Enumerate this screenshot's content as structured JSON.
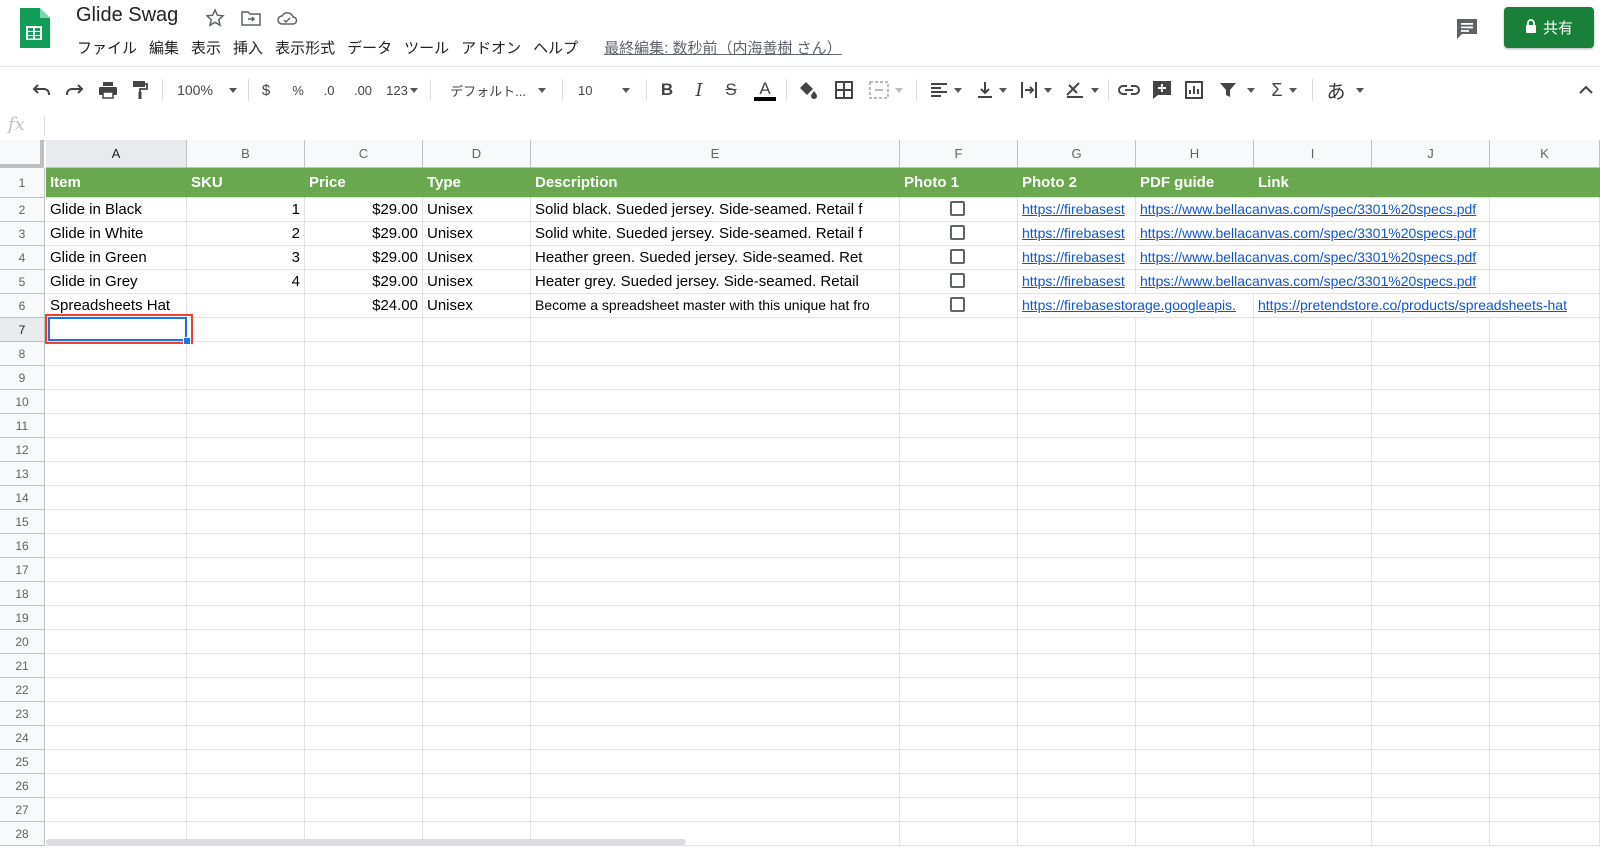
{
  "app": {
    "doc_title": "Glide Swag",
    "last_edit": "最終編集: 数秒前（内海善樹 さん）",
    "share_label": "共有"
  },
  "menu": [
    "ファイル",
    "編集",
    "表示",
    "挿入",
    "表示形式",
    "データ",
    "ツール",
    "アドオン",
    "ヘルプ"
  ],
  "toolbar": {
    "zoom": "100%",
    "currency": "$",
    "percent": "%",
    "decimal_decrease": ".0",
    "decimal_increase": ".00",
    "number_format": "123",
    "font": "デフォルト...",
    "font_size": "10",
    "input_tools": "あ"
  },
  "formula_bar": {
    "icon_label": "fx",
    "value": ""
  },
  "columns": [
    "A",
    "B",
    "C",
    "D",
    "E",
    "F",
    "G",
    "H",
    "I",
    "J",
    "K"
  ],
  "active_column": "A",
  "row_numbers": [
    "1",
    "2",
    "3",
    "4",
    "5",
    "6",
    "7",
    "8",
    "9",
    "10",
    "11",
    "12",
    "13",
    "14",
    "15",
    "16",
    "17",
    "18",
    "19",
    "20",
    "21",
    "22",
    "23",
    "24",
    "25",
    "26",
    "27",
    "28"
  ],
  "active_row": "7",
  "header_row": {
    "item": "Item",
    "sku": "SKU",
    "price": "Price",
    "type": "Type",
    "description": "Description",
    "photo1": "Photo 1",
    "photo2": "Photo 2",
    "pdf_guide": "PDF guide",
    "link": "Link"
  },
  "rows": [
    {
      "item": "Glide in Black",
      "sku": "1",
      "price": "$29.00",
      "type": "Unisex",
      "description": "Solid black. Sueded jersey. Side-seamed. Retail f",
      "photo2": "https://firebasest",
      "pdf_guide": "https://www.bellacanvas.com/spec/3301%20specs.pdf",
      "link": ""
    },
    {
      "item": "Glide in White",
      "sku": "2",
      "price": "$29.00",
      "type": "Unisex",
      "description": "Solid white. Sueded jersey. Side-seamed. Retail f",
      "photo2": "https://firebasest",
      "pdf_guide": "https://www.bellacanvas.com/spec/3301%20specs.pdf",
      "link": ""
    },
    {
      "item": "Glide in Green",
      "sku": "3",
      "price": "$29.00",
      "type": "Unisex",
      "description": "Heather green. Sueded jersey. Side-seamed. Ret",
      "photo2": "https://firebasest",
      "pdf_guide": "https://www.bellacanvas.com/spec/3301%20specs.pdf",
      "link": ""
    },
    {
      "item": "Glide in Grey",
      "sku": "4",
      "price": "$29.00",
      "type": "Unisex",
      "description": "Heater grey. Sueded jersey. Side-seamed. Retail",
      "photo2": "https://firebasest",
      "pdf_guide": "https://www.bellacanvas.com/spec/3301%20specs.pdf",
      "link": ""
    },
    {
      "item": "Spreadsheets Hat",
      "sku": "",
      "price": "$24.00",
      "type": "Unisex",
      "description": "Become a spreadsheet master with this unique hat fro",
      "photo2": "https://firebasestorage.googleapis.",
      "pdf_guide": "",
      "link": "https://pretendstore.co/products/spreadsheets-hat"
    }
  ],
  "colors": {
    "header_green": "#6aa84f",
    "share_green": "#188038",
    "link_blue": "#1155cc",
    "selection_blue": "#1a73e8",
    "highlight_red": "#ea4335"
  }
}
